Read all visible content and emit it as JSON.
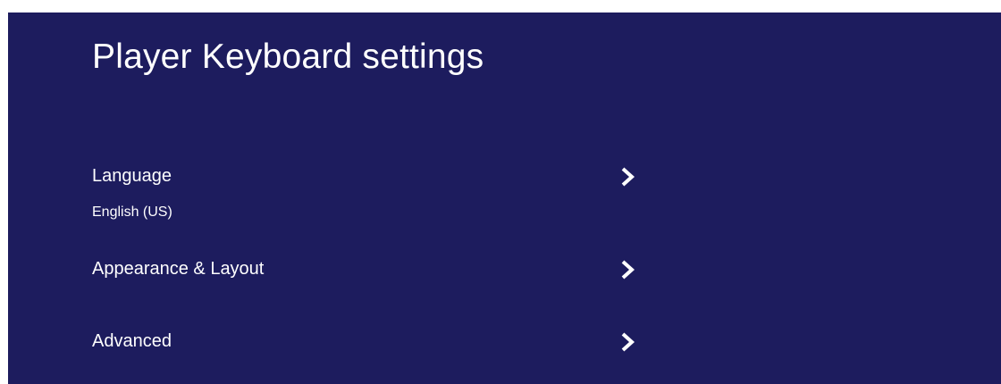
{
  "colors": {
    "background": "#1d1c5e",
    "text": "#ffffff"
  },
  "header": {
    "title": "Player Keyboard settings"
  },
  "settings": {
    "items": [
      {
        "label": "Language",
        "value": "English (US)",
        "icon": "chevron-right-icon"
      },
      {
        "label": "Appearance & Layout",
        "icon": "chevron-right-icon"
      },
      {
        "label": "Advanced",
        "icon": "chevron-right-icon"
      }
    ]
  }
}
